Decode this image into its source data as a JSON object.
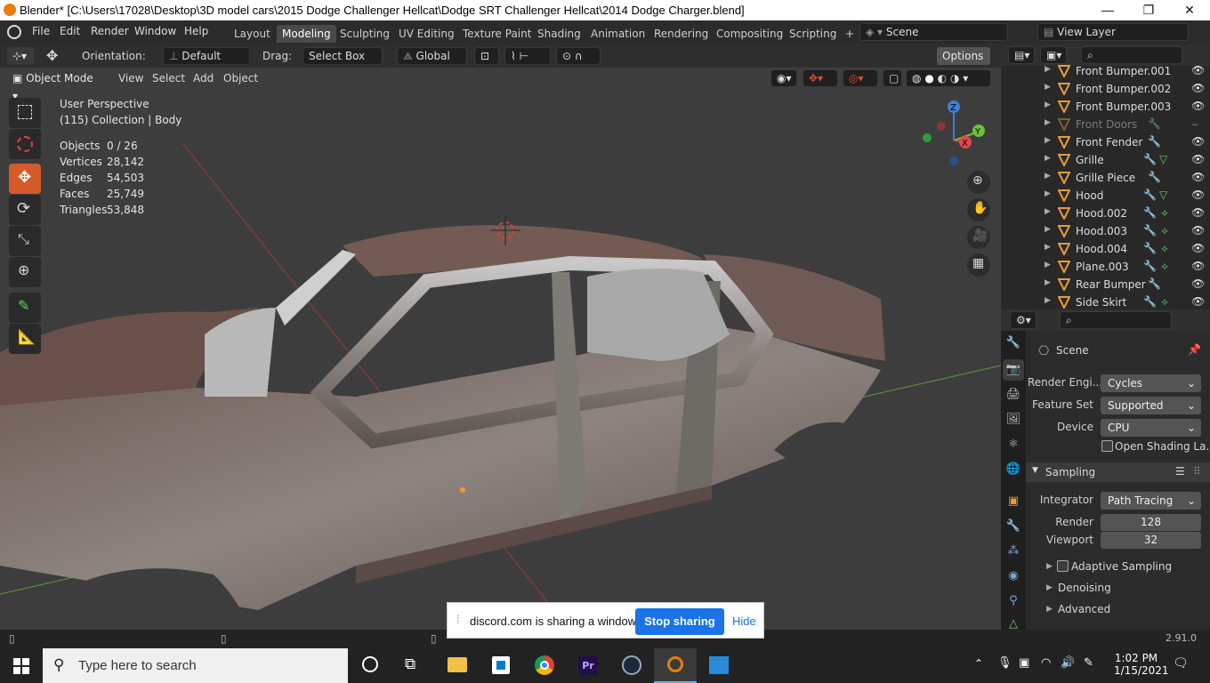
{
  "titlebar": {
    "title": "Blender* [C:\\Users\\17028\\Desktop\\3D model cars\\2015 Dodge Challenger Hellcat\\Dodge SRT Challenger Hellcat\\2014 Dodge Charger.blend]",
    "minimize": "—",
    "maximize": "❐",
    "close": "✕"
  },
  "menubar": {
    "items": [
      "File",
      "Edit",
      "Render",
      "Window",
      "Help"
    ]
  },
  "workspaces": {
    "tabs": [
      "Layout",
      "Modeling",
      "Sculpting",
      "UV Editing",
      "Texture Paint",
      "Shading",
      "Animation",
      "Rendering",
      "Compositing",
      "Scripting"
    ],
    "active": "Modeling",
    "add": "+"
  },
  "scene": {
    "name": "Scene",
    "view_layer": "View Layer"
  },
  "tool_header": {
    "orientation_label": "Orientation:",
    "orientation_value": "Default",
    "drag_label": "Drag:",
    "drag_value": "Select Box",
    "transform_value": "Global",
    "options": "Options"
  },
  "viewport_header": {
    "mode": "Object Mode",
    "menus": [
      "View",
      "Select",
      "Add",
      "Object"
    ]
  },
  "viewport_info": {
    "perspective": "User Perspective",
    "collection": "(115) Collection | Body",
    "stats": [
      {
        "label": "Objects",
        "value": "0 / 26"
      },
      {
        "label": "Vertices",
        "value": "28,142"
      },
      {
        "label": "Edges",
        "value": "54,503"
      },
      {
        "label": "Faces",
        "value": "25,749"
      },
      {
        "label": "Triangles",
        "value": "53,848"
      }
    ]
  },
  "gizmo": {
    "z": "Z",
    "y": "Y",
    "x": "X"
  },
  "outliner": {
    "items": [
      {
        "name": "Front Bumper.001",
        "dimmed": false,
        "mods": ""
      },
      {
        "name": "Front Bumper.002",
        "dimmed": false,
        "mods": ""
      },
      {
        "name": "Front Bumper.003",
        "dimmed": false,
        "mods": ""
      },
      {
        "name": "Front Doors",
        "dimmed": true,
        "mods": "wrench"
      },
      {
        "name": "Front Fender",
        "dimmed": false,
        "mods": "wrench"
      },
      {
        "name": "Grille",
        "dimmed": false,
        "mods": "wrench-mesh"
      },
      {
        "name": "Grille Piece",
        "dimmed": false,
        "mods": "wrench"
      },
      {
        "name": "Hood",
        "dimmed": false,
        "mods": "wrench-mesh"
      },
      {
        "name": "Hood.002",
        "dimmed": false,
        "mods": "wrench-curve"
      },
      {
        "name": "Hood.003",
        "dimmed": false,
        "mods": "wrench-curve"
      },
      {
        "name": "Hood.004",
        "dimmed": false,
        "mods": "wrench-curve"
      },
      {
        "name": "Plane.003",
        "dimmed": false,
        "mods": "wrench-curve"
      },
      {
        "name": "Rear Bumper",
        "dimmed": false,
        "mods": "wrench"
      },
      {
        "name": "Side Skirt",
        "dimmed": false,
        "mods": "wrench-curve"
      }
    ]
  },
  "properties": {
    "scene_label": "Scene",
    "render_engine_label": "Render Engi...",
    "render_engine_value": "Cycles",
    "feature_set_label": "Feature Set",
    "feature_set_value": "Supported",
    "device_label": "Device",
    "device_value": "CPU",
    "open_shading": "Open Shading La...",
    "sampling_label": "Sampling",
    "integrator_label": "Integrator",
    "integrator_value": "Path Tracing",
    "render_label": "Render",
    "render_value": "128",
    "viewport_label": "Viewport",
    "viewport_value": "32",
    "adaptive_sampling": "Adaptive Sampling",
    "denoising": "Denoising",
    "advanced": "Advanced"
  },
  "statusbar": {
    "version": "2.91.0"
  },
  "share_notice": {
    "text": "discord.com is sharing a window.",
    "stop": "Stop sharing",
    "hide": "Hide"
  },
  "taskbar": {
    "search_placeholder": "Type here to search",
    "time": "1:02 PM",
    "date": "1/15/2021"
  },
  "colors": {
    "accent_blue": "#4772b3",
    "blender_orange": "#e87d0d",
    "active_tool": "#d35b2a",
    "object_icon": "#e89b3c",
    "discord_blue": "#1a73e8"
  }
}
